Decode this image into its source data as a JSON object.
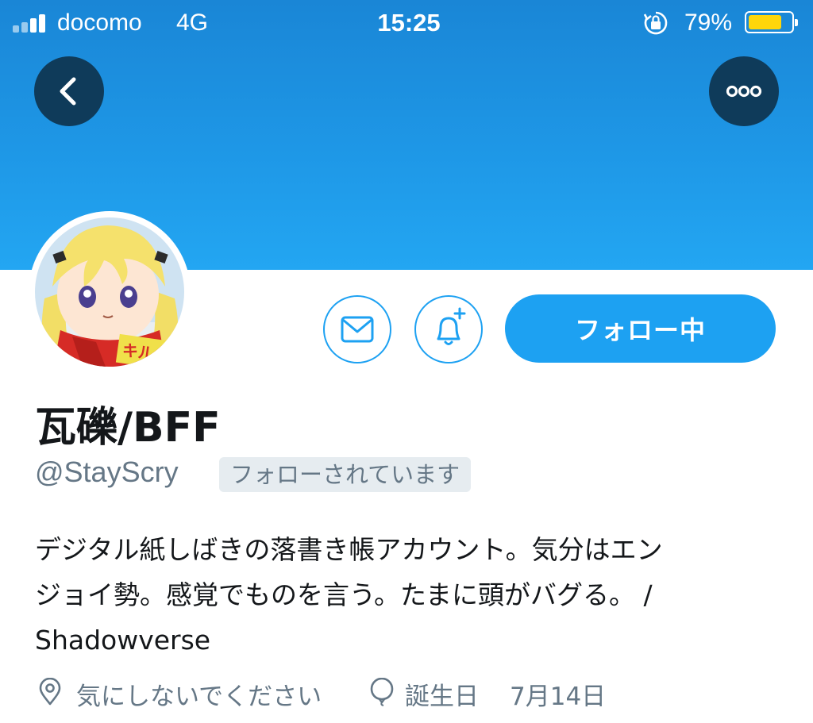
{
  "status_bar": {
    "carrier": "docomo",
    "network": "4G",
    "time": "15:25",
    "battery_percent": "79%",
    "battery_level": 0.79,
    "battery_color": "#ffd60a"
  },
  "header": {
    "back_icon": "chevron-left-icon",
    "more_icon": "more-horizontal-icon",
    "banner_color": "#1da1f2"
  },
  "profile": {
    "avatar_text": "キルミーベイベー",
    "name": "瓦礫/BFF",
    "handle": "@StayScry",
    "follows_you": "フォローされています",
    "bio_lines": [
      "デジタル紙しばきの落書き帳アカウント。気分はエン",
      "ジョイ勢。感覚でものを言う。たまに頭がバグる。 /",
      "Shadowverse"
    ],
    "location": "気にしないでください",
    "birthday_label": "誕生日",
    "birthday_value": "7月14日"
  },
  "actions": {
    "message_icon": "mail-icon",
    "notify_icon": "bell-plus-icon",
    "follow_label": "フォロー中",
    "accent_color": "#1da1f2"
  }
}
